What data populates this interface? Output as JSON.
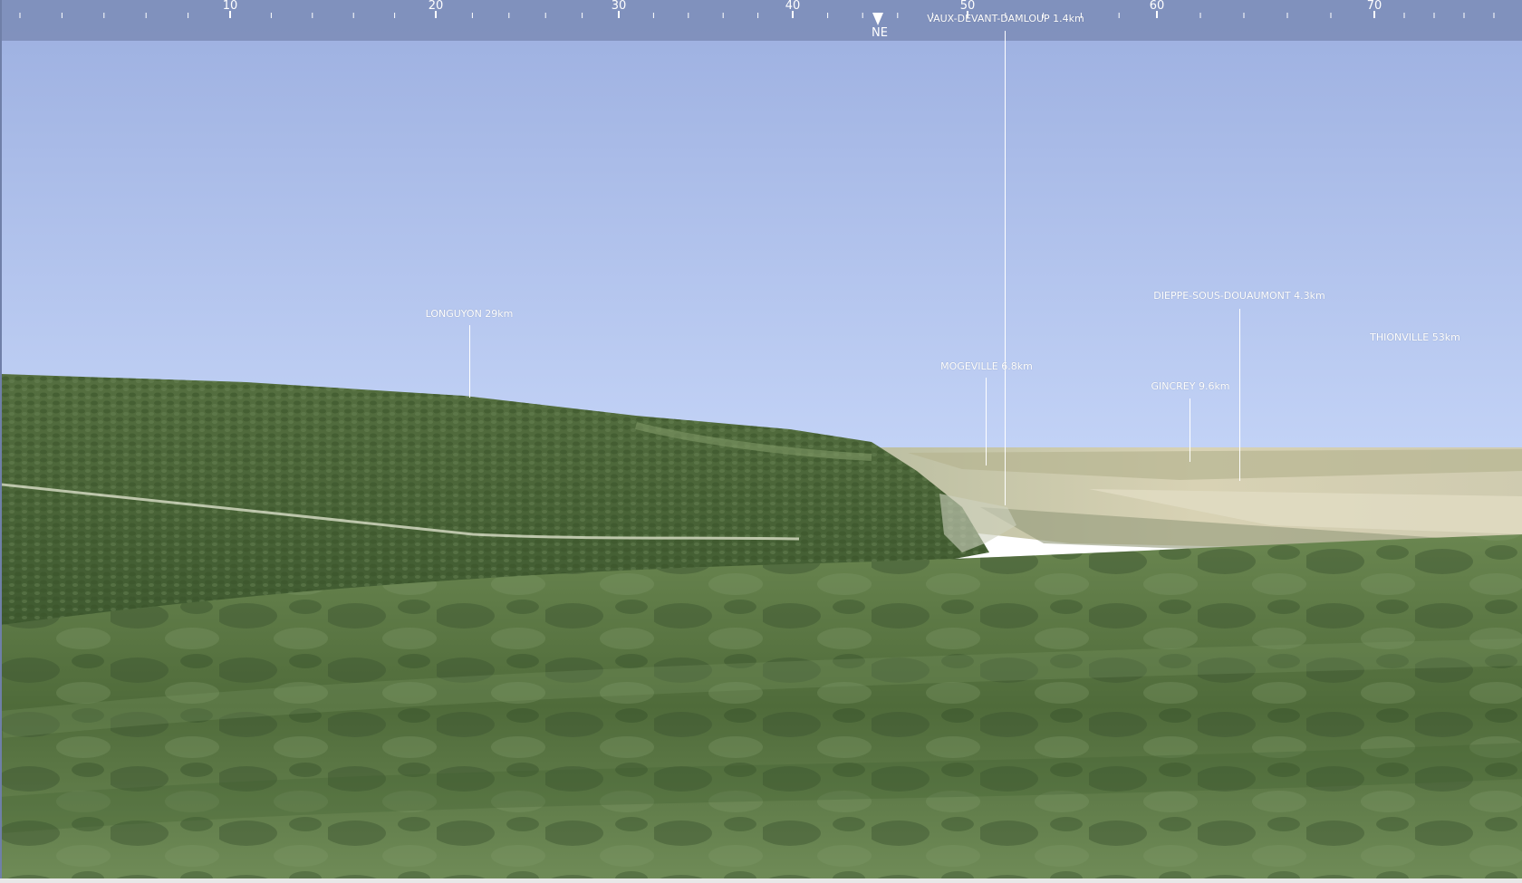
{
  "compass": {
    "ticks": [
      "10",
      "20",
      "30",
      "40",
      "50",
      "60",
      "70"
    ],
    "heading": "NE"
  },
  "places": [
    {
      "label": "LONGUYON 29km"
    },
    {
      "label": "VAUX-DEVANT-DAMLOUP 1.4km"
    },
    {
      "label": "MOGEVILLE 6.8km"
    },
    {
      "label": "DIEPPE-SOUS-DOUAUMONT 4.3km"
    },
    {
      "label": "GINCREY 9.6km"
    },
    {
      "label": "THIONVILLE 53km"
    }
  ],
  "colors": {
    "sky_top": "#9fb2e2",
    "sky_bottom": "#c3d3f6",
    "hill": "#4e6b3a",
    "foreground": "#5d7a44",
    "plain": "#cfcaa9",
    "compass_bar": "#7e8eba"
  }
}
